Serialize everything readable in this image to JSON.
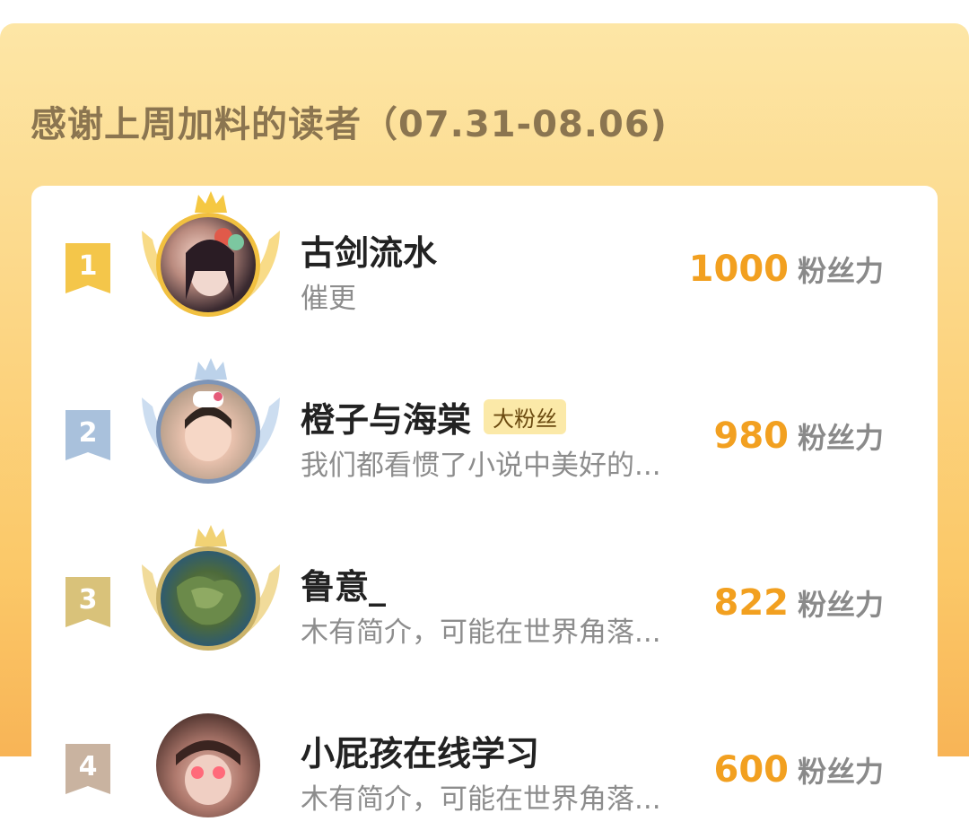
{
  "panel": {
    "title": "感谢上周加料的读者（07.31-08.06)"
  },
  "ranking": [
    {
      "rank": "1",
      "name": "古剑流水",
      "tag": "",
      "desc": "催更",
      "score": "1000",
      "unit": "粉丝力"
    },
    {
      "rank": "2",
      "name": "橙子与海棠",
      "tag": "大粉丝",
      "desc": "我们都看惯了小说中美好的...",
      "score": "980",
      "unit": "粉丝力"
    },
    {
      "rank": "3",
      "name": "鲁意_",
      "tag": "",
      "desc": "木有简介，可能在世界角落...",
      "score": "822",
      "unit": "粉丝力"
    },
    {
      "rank": "4",
      "name": "小屁孩在线学习",
      "tag": "",
      "desc": "木有简介，可能在世界角落...",
      "score": "600",
      "unit": "粉丝力"
    }
  ],
  "colors": {
    "gold": "#f1c040",
    "silver": "#a9c1dc",
    "bronze": "#d9c27a",
    "fourth": "#c9b3a0",
    "score": "#f2a020"
  },
  "icons": {
    "rank1": "crown-icon",
    "rank2": "crown-icon",
    "rank3": "crown-icon"
  }
}
